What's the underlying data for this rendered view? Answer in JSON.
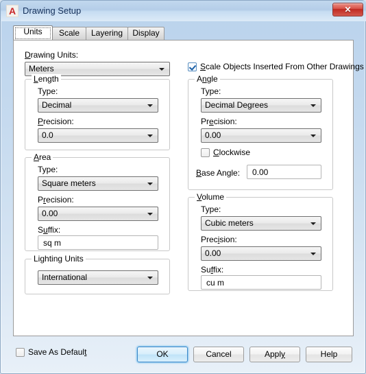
{
  "window": {
    "title": "Drawing Setup",
    "app_icon": "autocad-a-icon",
    "close_label": "✕"
  },
  "tabs": [
    {
      "label": "Units",
      "active": true
    },
    {
      "label": "Scale",
      "active": false
    },
    {
      "label": "Layering",
      "active": false
    },
    {
      "label": "Display",
      "active": false
    }
  ],
  "units_tab": {
    "drawing_units": {
      "label": "Drawing Units:",
      "value": "Meters"
    },
    "scale_objects": {
      "label": "Scale Objects Inserted From Other Drawings",
      "checked": true
    },
    "length": {
      "title": "Length",
      "type_label": "Type:",
      "type_value": "Decimal",
      "precision_label": "Precision:",
      "precision_value": "0.0"
    },
    "area": {
      "title": "Area",
      "type_label": "Type:",
      "type_value": "Square meters",
      "precision_label": "Precision:",
      "precision_value": "0.00",
      "suffix_label": "Suffix:",
      "suffix_value": "sq m"
    },
    "lighting_units": {
      "title": "Lighting Units",
      "value": "International"
    },
    "angle": {
      "title": "Angle",
      "type_label": "Type:",
      "type_value": "Decimal Degrees",
      "precision_label": "Precision:",
      "precision_value": "0.00",
      "clockwise_label": "Clockwise",
      "clockwise_checked": false,
      "base_angle_label": "Base Angle:",
      "base_angle_value": "0.00"
    },
    "volume": {
      "title": "Volume",
      "type_label": "Type:",
      "type_value": "Cubic meters",
      "precision_label": "Precision:",
      "precision_value": "0.00",
      "suffix_label": "Suffix:",
      "suffix_value": "cu m"
    }
  },
  "footer": {
    "save_as_default": {
      "label": "Save As Default",
      "checked": false
    },
    "ok_label": "OK",
    "cancel_label": "Cancel",
    "apply_label": "Apply",
    "help_label": "Help"
  },
  "colors": {
    "titlebar_blue": "#b4cde8",
    "close_red": "#bf2a22",
    "accent_blue": "#3c87c8",
    "logo_red": "#c8262a",
    "panel_bg": "#ffffff",
    "group_border": "#c8c8c8"
  }
}
